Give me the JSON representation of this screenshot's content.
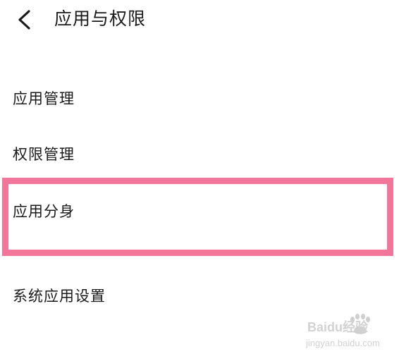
{
  "header": {
    "title": "应用与权限",
    "back_icon": "chevron-left-icon"
  },
  "menu": {
    "items": [
      {
        "label": "应用管理"
      },
      {
        "label": "权限管理"
      },
      {
        "label": "应用分身"
      },
      {
        "label": "系统应用设置"
      }
    ]
  },
  "highlight": {
    "color": "#f27699"
  },
  "watermark": {
    "brand": "Baidu经验",
    "url": "jingyan.baidu.com"
  }
}
